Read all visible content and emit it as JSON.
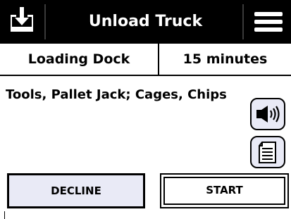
{
  "header": {
    "title": "Unload Truck",
    "left_icon": "download-icon",
    "right_icon": "menu-icon",
    "background": "#000000",
    "title_color": "#ffffff"
  },
  "info": {
    "location": "Loading Dock",
    "duration": "15 minutes"
  },
  "task": {
    "description": "Tools, Pallet Jack; Cages, Chips"
  },
  "side_buttons": {
    "audio_icon": "speaker-icon",
    "notes_icon": "notes-icon",
    "background": "#e9eaf6"
  },
  "actions": {
    "decline_label": "DECLINE",
    "start_label": "START"
  }
}
